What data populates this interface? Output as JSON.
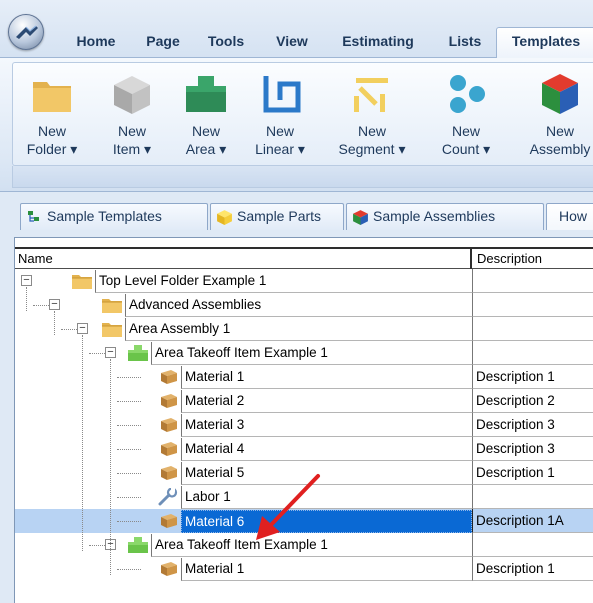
{
  "ribbon_tabs": [
    "Home",
    "Page",
    "Tools",
    "View",
    "Estimating",
    "Lists",
    "Templates"
  ],
  "active_tab": "Templates",
  "ribbon_buttons": [
    {
      "line1": "New",
      "line2": "Folder ▾",
      "icon": "folder-icon"
    },
    {
      "line1": "New",
      "line2": "Item ▾",
      "icon": "item-cube-icon"
    },
    {
      "line1": "New",
      "line2": "Area ▾",
      "icon": "area-icon"
    },
    {
      "line1": "New",
      "line2": "Linear ▾",
      "icon": "linear-icon"
    },
    {
      "line1": "New",
      "line2": "Segment ▾",
      "icon": "segment-icon"
    },
    {
      "line1": "New",
      "line2": "Count ▾",
      "icon": "count-icon"
    },
    {
      "line1": "New",
      "line2": "Assembly",
      "icon": "assembly-icon"
    }
  ],
  "doc_tabs": [
    {
      "label": "Sample Templates",
      "icon": "templates-tree-icon"
    },
    {
      "label": "Sample Parts",
      "icon": "parts-cube-icon"
    },
    {
      "label": "Sample Assemblies",
      "icon": "assemblies-cube-icon"
    },
    {
      "label": "How",
      "icon": ""
    }
  ],
  "grid": {
    "columns": {
      "name": "Name",
      "description": "Description"
    },
    "rows": [
      {
        "name": "Top Level Folder Example 1",
        "description": "",
        "icon": "folder-icon",
        "expander": "−"
      },
      {
        "name": "Advanced Assemblies",
        "description": "",
        "icon": "folder-icon",
        "expander": "−"
      },
      {
        "name": "Area Assembly 1",
        "description": "",
        "icon": "folder-icon",
        "expander": "−"
      },
      {
        "name": "Area Takeoff Item Example 1",
        "description": "",
        "icon": "area-item-icon",
        "expander": "−"
      },
      {
        "name": "Material 1",
        "description": "Description 1",
        "icon": "material-box-icon",
        "expander": ""
      },
      {
        "name": "Material 2",
        "description": "Description 2",
        "icon": "material-box-icon",
        "expander": ""
      },
      {
        "name": "Material 3",
        "description": "Description 3",
        "icon": "material-box-icon",
        "expander": ""
      },
      {
        "name": "Material 4",
        "description": "Description 3",
        "icon": "material-box-icon",
        "expander": ""
      },
      {
        "name": "Material 5",
        "description": "Description 1",
        "icon": "material-box-icon",
        "expander": ""
      },
      {
        "name": "Labor 1",
        "description": "",
        "icon": "labor-wrench-icon",
        "expander": ""
      },
      {
        "name": "Material 6",
        "description": "Description 1A",
        "icon": "material-box-icon",
        "expander": "",
        "selected": true
      },
      {
        "name": "Area Takeoff Item Example 1",
        "description": "",
        "icon": "area-item-icon",
        "expander": "−"
      },
      {
        "name": "Material 1",
        "description": "Description 1",
        "icon": "material-box-icon",
        "expander": ""
      }
    ]
  },
  "colors": {
    "selection": "#0a69d4",
    "row_highlight": "#b8d3f3",
    "annotation_arrow": "#e02020"
  }
}
